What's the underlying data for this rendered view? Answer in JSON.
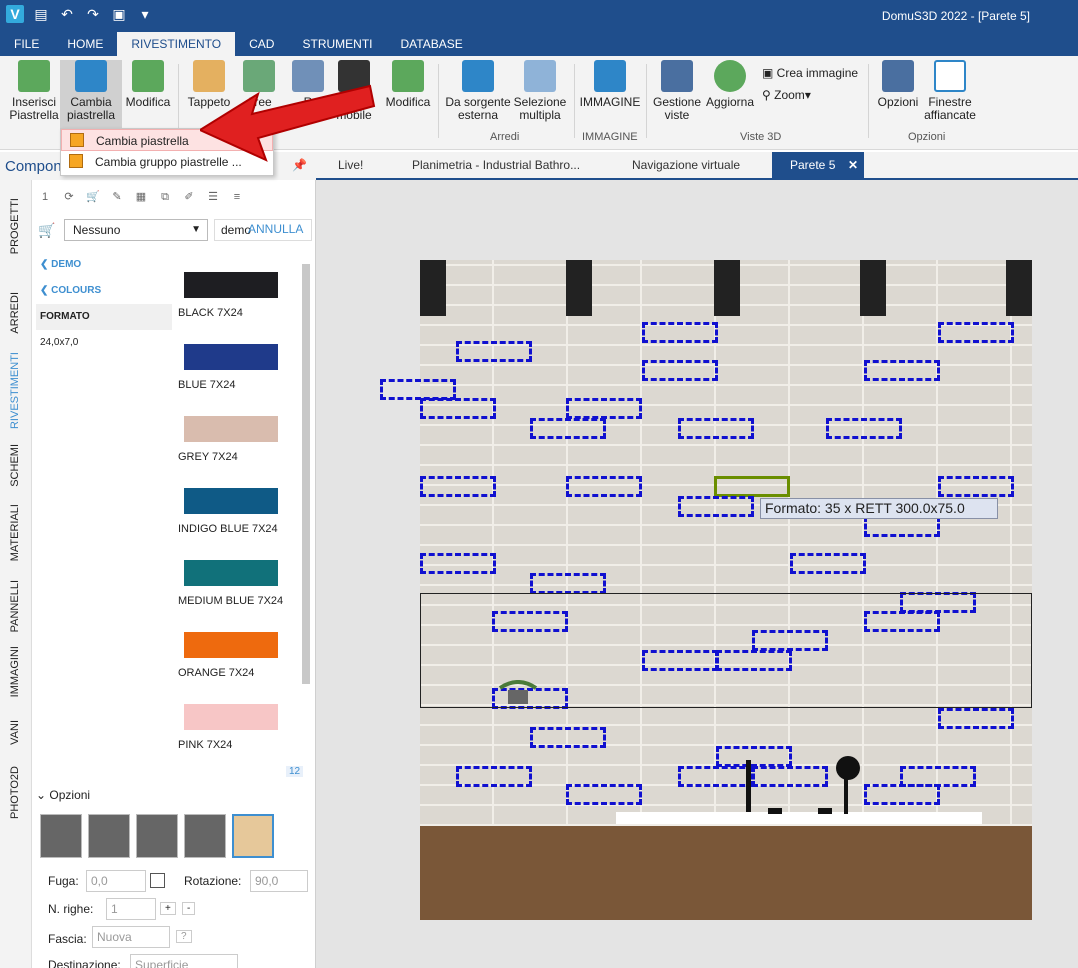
{
  "window": {
    "title": "DomuS3D 2022 - [Parete 5]"
  },
  "menubar": {
    "tabs": [
      "FILE",
      "HOME",
      "RIVESTIMENTO",
      "CAD",
      "STRUMENTI",
      "DATABASE"
    ],
    "active": "RIVESTIMENTO"
  },
  "ribbon": {
    "inserisci": "Inserisci Piastrella",
    "cambia": "Cambia piastrella",
    "modifica": "Modifica",
    "tappeto": "Tappeto",
    "aree": "Aree",
    "rmodulo": "R",
    "modulo": "Modulo mobile",
    "modifica2": "Modifica",
    "da_sorgente": "Da sorgente esterna",
    "selezione": "Selezione multipla",
    "group_arredi": "Arredi",
    "immagine": "IMMAGINE",
    "group_immagine": "IMMAGINE",
    "gestione": "Gestione viste",
    "aggiorna": "Aggiorna",
    "crea_immagine": "Crea immagine",
    "zoom": "Zoom",
    "group_viste": "Viste 3D",
    "opzioni": "Opzioni",
    "finestre": "Finestre affiancate",
    "group_opzioni": "Opzioni"
  },
  "dropdown": {
    "items": [
      "Cambia piastrella",
      "Cambia gruppo piastrelle ..."
    ]
  },
  "leftpanel": {
    "title": "Compon",
    "vtabs": [
      "PROGETTI",
      "ARREDI",
      "RIVESTIMENTI",
      "SCHEMI",
      "MATERIALI",
      "PANNELLI",
      "IMMAGINI",
      "VANI",
      "PHOTO2D"
    ],
    "active_vtab": "RIVESTIMENTI",
    "filter": {
      "select": "Nessuno",
      "search": "demo",
      "cancel": "ANNULLA"
    },
    "nav": {
      "demo": "DEMO",
      "colours": "COLOURS",
      "format_header": "FORMATO",
      "format_value": "24,0x7,0"
    },
    "tiles": [
      {
        "name": "BLACK 7X24",
        "color": "#1e1e22"
      },
      {
        "name": "BLUE 7X24",
        "color": "#1f3a8a"
      },
      {
        "name": "GREY 7X24",
        "color": "#d9bcae"
      },
      {
        "name": "INDIGO BLUE 7X24",
        "color": "#0f5a86"
      },
      {
        "name": "MEDIUM BLUE 7X24",
        "color": "#11717a"
      },
      {
        "name": "ORANGE 7X24",
        "color": "#ee6a0e"
      },
      {
        "name": "PINK 7X24",
        "color": "#f7c6c6"
      }
    ],
    "count": "12",
    "options": {
      "label": "Opzioni"
    },
    "fields": {
      "fuga_label": "Fuga:",
      "fuga": "0,0",
      "rotazione_label": "Rotazione:",
      "rotazione": "90,0",
      "righe_label": "N. righe:",
      "righe": "1",
      "fascia_label": "Fascia:",
      "fascia": "Nuova",
      "dest_label": "Destinazione:",
      "dest": "Superficie"
    }
  },
  "doctabs": {
    "tabs": [
      "Live!",
      "Planimetria - Industrial Bathro...",
      "Navigazione virtuale",
      "Parete 5"
    ],
    "active": "Parete 5"
  },
  "canvas": {
    "tooltip": "Formato: 35 x RETT 300.0x75.0"
  }
}
